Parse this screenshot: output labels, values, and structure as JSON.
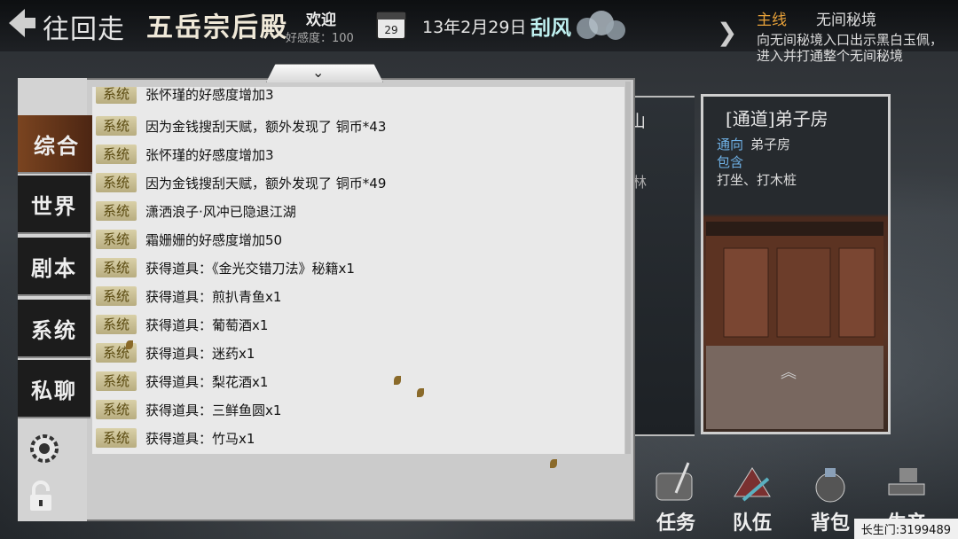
{
  "topbar": {
    "back_label": "往回走",
    "location": "五岳宗后殿",
    "welcome": "欢迎",
    "affinity": "好感度：100",
    "date": "13年2月29日",
    "weather": "刮风"
  },
  "quest": {
    "type": "主线",
    "name": "无间秘境",
    "desc": "向无间秘境入口出示黑白玉佩，进入并打通整个无间秘境"
  },
  "scene": {
    "left_card_title": "山",
    "left_card_text": "林",
    "room_title": "[通道]弟子房",
    "room_to_label": "通向",
    "room_to_val": "弟子房",
    "room_contains_label": "包含",
    "room_contains_val": "打坐、打木桩"
  },
  "chat": {
    "tabs": [
      "综合",
      "世界",
      "剧本",
      "系统",
      "私聊"
    ],
    "active_tab": 0,
    "tag_label": "系统",
    "messages": [
      "张怀瑾的好感度增加3",
      "因为金钱搜刮天赋，额外发现了 铜币*43",
      "张怀瑾的好感度增加3",
      "因为金钱搜刮天赋，额外发现了 铜币*49",
      "潇洒浪子·风冲已隐退江湖",
      "霜姗姗的好感度增加50",
      "获得道具：《金光交错刀法》秘籍x1",
      "获得道具：煎扒青鱼x1",
      "获得道具：葡萄酒x1",
      "获得道具：迷药x1",
      "获得道具：梨花酒x1",
      "获得道具：三鲜鱼圆x1",
      "获得道具：竹马x1"
    ]
  },
  "bottom_menu": [
    {
      "label": "任务",
      "icon": "scroll-icon"
    },
    {
      "label": "队伍",
      "icon": "team-icon"
    },
    {
      "label": "背包",
      "icon": "bag-icon"
    },
    {
      "label": "生产",
      "icon": "anvil-icon"
    }
  ],
  "player_id": "长生门:3199489",
  "colors": {
    "accent": "#e8a23a",
    "link": "#6fb1e6",
    "active_tab": "#7a4420"
  }
}
